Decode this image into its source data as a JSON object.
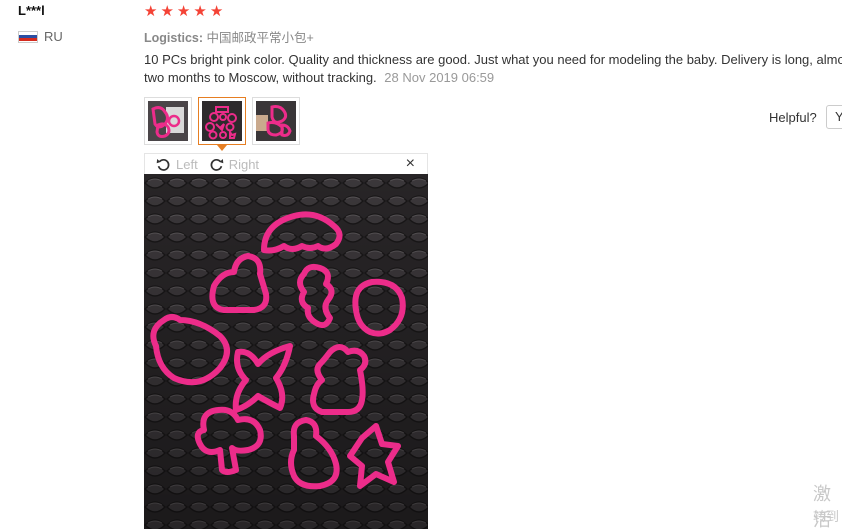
{
  "review": {
    "username": "L***l",
    "country": "RU",
    "stars": [
      "★",
      "★",
      "★",
      "★",
      "★"
    ],
    "logistics_label": "Logistics:",
    "logistics_value": "中国邮政平常小包+",
    "text": "10 PCs bright pink color. Quality and thickness are good. Just what you need for modeling the baby. Delivery is long, almost two months to Moscow, without tracking.",
    "date": "28 Nov 2019 06:59"
  },
  "viewer": {
    "rotate_left": "Left",
    "rotate_right": "Right",
    "close": "×"
  },
  "helpful": {
    "label": "Helpful?",
    "yes_partial": "Y"
  },
  "watermark": {
    "line1": "激活",
    "line2": "转到"
  },
  "colors": {
    "star": "#f44336",
    "accent": "#e67e22",
    "cutter_pink": "#ec2c8a"
  }
}
